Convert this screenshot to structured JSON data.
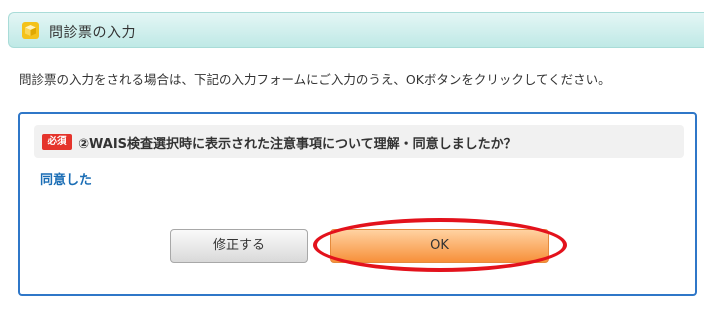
{
  "header": {
    "icon": "cube-icon",
    "title": "問診票の入力"
  },
  "intro_text": "問診票の入力をされる場合は、下記の入力フォームにご入力のうえ、OKボタンをクリックしてください。",
  "question": {
    "required_badge": "必須",
    "text": "②WAIS検査選択時に表示された注意事項について理解・同意しましたか？",
    "answer": "同意した"
  },
  "buttons": {
    "fix_label": "修正する",
    "ok_label": "OK"
  },
  "colors": {
    "accent_blue": "#2f77c8",
    "ok_orange": "#f7903a",
    "highlight_red": "#e3121c",
    "required_red": "#e5342c"
  }
}
